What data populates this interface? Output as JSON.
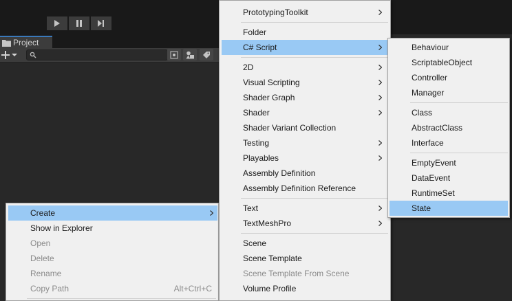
{
  "editor": {
    "project_tab": {
      "label": "Project",
      "icon": "folder-icon"
    },
    "play_controls": [
      "play-icon",
      "pause-icon",
      "step-icon"
    ],
    "toolbar_icons": [
      "search-icon",
      "filter-by-type-icon",
      "filter-by-label-icon",
      "add-plus-icon"
    ]
  },
  "context_menu": {
    "items": [
      {
        "label": "Create",
        "state": "highlighted",
        "submenu": true
      },
      {
        "label": "Show in Explorer",
        "state": "enabled"
      },
      {
        "label": "Open",
        "state": "disabled"
      },
      {
        "label": "Delete",
        "state": "disabled"
      },
      {
        "label": "Rename",
        "state": "disabled"
      },
      {
        "label": "Copy Path",
        "state": "disabled",
        "shortcut": "Alt+Ctrl+C"
      }
    ]
  },
  "create_menu": {
    "items": [
      {
        "label": "PrototypingToolkit",
        "submenu": true
      },
      {
        "label": "Folder"
      },
      {
        "label": "C# Script",
        "submenu": true,
        "state": "highlighted"
      },
      {
        "label": "2D",
        "submenu": true
      },
      {
        "label": "Visual Scripting",
        "submenu": true
      },
      {
        "label": "Shader Graph",
        "submenu": true
      },
      {
        "label": "Shader",
        "submenu": true
      },
      {
        "label": "Shader Variant Collection"
      },
      {
        "label": "Testing",
        "submenu": true
      },
      {
        "label": "Playables",
        "submenu": true
      },
      {
        "label": "Assembly Definition"
      },
      {
        "label": "Assembly Definition Reference"
      },
      {
        "label": "Text",
        "submenu": true
      },
      {
        "label": "TextMeshPro",
        "submenu": true
      },
      {
        "label": "Scene"
      },
      {
        "label": "Scene Template"
      },
      {
        "label": "Scene Template From Scene",
        "state": "disabled"
      },
      {
        "label": "Volume Profile"
      }
    ]
  },
  "csharp_menu": {
    "items": [
      {
        "label": "Behaviour"
      },
      {
        "label": "ScriptableObject"
      },
      {
        "label": "Controller"
      },
      {
        "label": "Manager"
      },
      {
        "label": "Class"
      },
      {
        "label": "AbstractClass"
      },
      {
        "label": "Interface"
      },
      {
        "label": "EmptyEvent"
      },
      {
        "label": "DataEvent"
      },
      {
        "label": "RuntimeSet"
      },
      {
        "label": "State",
        "state": "highlighted"
      }
    ]
  },
  "colors": {
    "menu_bg": "#f0f0f0",
    "highlight": "#99c9f4",
    "disabled_text": "#8a8a8a",
    "editor_bg": "#282828",
    "toolbar_bg": "#191919"
  }
}
